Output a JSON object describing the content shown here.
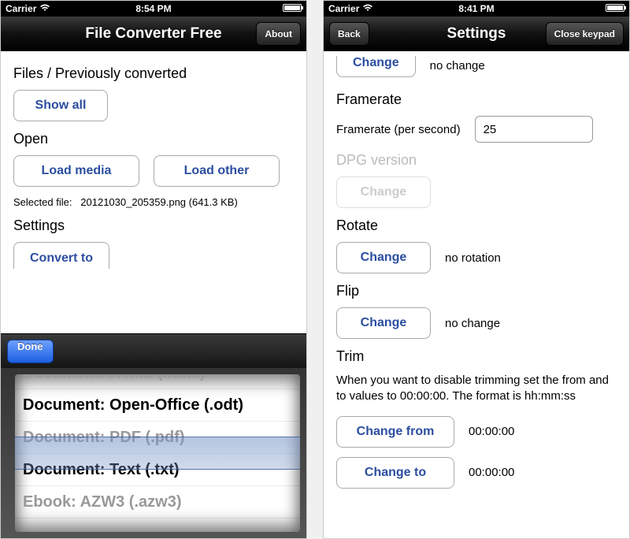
{
  "left": {
    "status": {
      "carrier": "Carrier",
      "time": "8:54 PM"
    },
    "nav": {
      "title": "File Converter Free",
      "about": "About"
    },
    "section_files": "Files / Previously converted",
    "show_all": "Show all",
    "section_open": "Open",
    "load_media": "Load media",
    "load_other": "Load other",
    "selected_label": "Selected file:",
    "selected_value": "20121030_205359.png (641.3 KB)",
    "section_settings": "Settings",
    "convert_to": "Convert to",
    "done": "Done",
    "picker": {
      "items": [
        "Document: HTML (.html)",
        "Document: Open-Office (.odt)",
        "Document: PDF (.pdf)",
        "Document: Text (.txt)",
        "Ebook: AZW3 (.azw3)"
      ],
      "selected_index": 2
    }
  },
  "right": {
    "status": {
      "carrier": "Carrier",
      "time": "8:41 PM"
    },
    "nav": {
      "back": "Back",
      "title": "Settings",
      "close": "Close keypad"
    },
    "change": "Change",
    "top_val": "no change",
    "framerate_title": "Framerate",
    "framerate_label": "Framerate (per second)",
    "framerate_value": "25",
    "dpg_title": "DPG version",
    "rotate_title": "Rotate",
    "rotate_val": "no rotation",
    "flip_title": "Flip",
    "flip_val": "no change",
    "trim_title": "Trim",
    "trim_desc": "When you want to disable trimming set the from and to values to 00:00:00. The format is hh:mm:ss",
    "change_from": "Change from",
    "change_to": "Change to",
    "time_zero": "00:00:00"
  }
}
